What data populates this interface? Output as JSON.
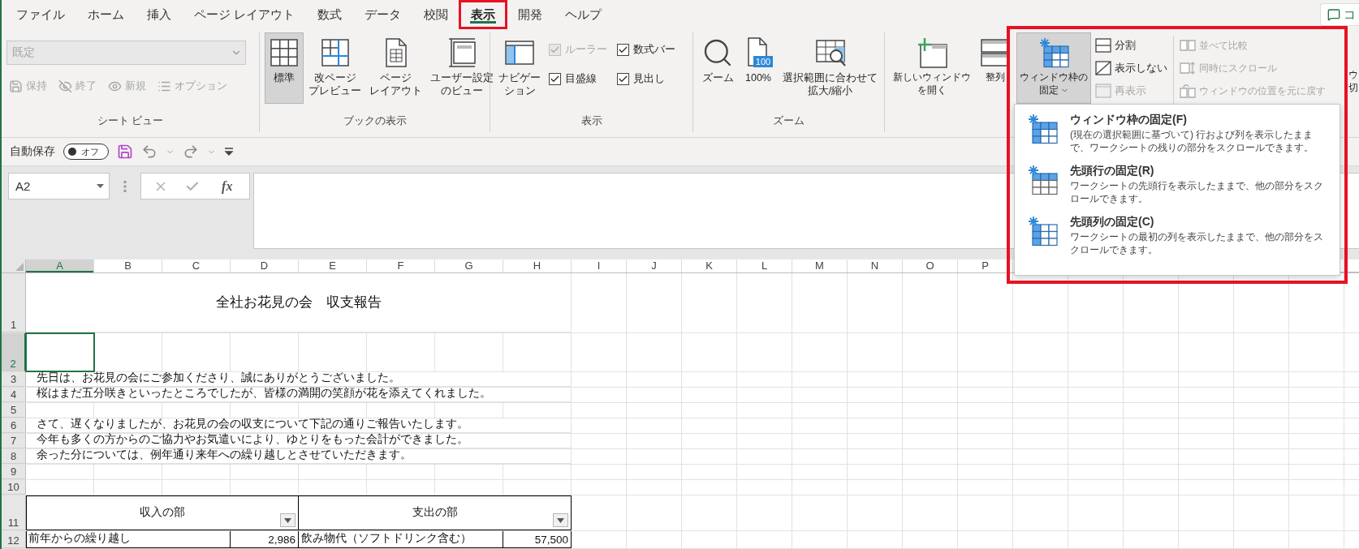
{
  "tabs": [
    {
      "label": "ファイル",
      "selected": false
    },
    {
      "label": "ホーム",
      "selected": false
    },
    {
      "label": "挿入",
      "selected": false
    },
    {
      "label": "ページ レイアウト",
      "selected": false
    },
    {
      "label": "数式",
      "selected": false
    },
    {
      "label": "データ",
      "selected": false
    },
    {
      "label": "校閲",
      "selected": false
    },
    {
      "label": "表示",
      "selected": true
    },
    {
      "label": "開発",
      "selected": false
    },
    {
      "label": "ヘルプ",
      "selected": false
    }
  ],
  "comment_button": {
    "label": "コ"
  },
  "ribbon": {
    "sheet_view": {
      "title": "シート ビュー",
      "view_select": {
        "value": "既定",
        "disabled": true
      },
      "buttons": [
        {
          "label": "保持",
          "disabled": true
        },
        {
          "label": "終了",
          "disabled": true
        },
        {
          "label": "新規",
          "disabled": true
        },
        {
          "label": "オプション",
          "disabled": true
        }
      ]
    },
    "workbook_views": {
      "title": "ブックの表示",
      "buttons": [
        {
          "lines": [
            "標準"
          ],
          "selected": true
        },
        {
          "lines": [
            "改ページ",
            "プレビュー"
          ],
          "selected": false
        },
        {
          "lines": [
            "ページ",
            "レイアウト"
          ],
          "selected": false
        },
        {
          "lines": [
            "ユーザー設定",
            "のビュー"
          ],
          "selected": false
        }
      ]
    },
    "show": {
      "title": "表示",
      "navigation": {
        "lines": [
          "ナビゲー",
          "ション"
        ]
      },
      "options": [
        {
          "label": "ルーラー",
          "checked": true,
          "disabled": true
        },
        {
          "label": "数式バー",
          "checked": true,
          "disabled": false
        },
        {
          "label": "目盛線",
          "checked": true,
          "disabled": false
        },
        {
          "label": "見出し",
          "checked": true,
          "disabled": false
        }
      ]
    },
    "zoom": {
      "title": "ズーム",
      "buttons": [
        {
          "lines": [
            "ズーム"
          ]
        },
        {
          "lines": [
            "100%"
          ],
          "badge": "100"
        },
        {
          "lines": [
            "選択範囲に合わせて",
            "拡大/縮小"
          ]
        }
      ]
    },
    "window": {
      "large_buttons": [
        {
          "lines": [
            "新しいウィンドウ",
            "を開く"
          ]
        },
        {
          "lines": [
            "整列"
          ]
        },
        {
          "lines": [
            "ウィンドウ枠の",
            "固定"
          ],
          "expanded": true
        }
      ],
      "view_options": [
        {
          "label": "分割",
          "disabled": false
        },
        {
          "label": "表示しない",
          "disabled": false
        },
        {
          "label": "再表示",
          "disabled": true
        }
      ],
      "side_by_side": [
        {
          "label": "並べて比較",
          "disabled": true
        },
        {
          "label": "同時にスクロール",
          "disabled": true
        },
        {
          "label": "ウィンドウの位置を元に戻す",
          "disabled": true
        }
      ],
      "switch_button": {
        "lines": [
          "ウ",
          "切"
        ]
      }
    }
  },
  "quick_access": {
    "autosave_label": "自動保存",
    "autosave": {
      "on": false,
      "label": "オフ"
    }
  },
  "formula_bar": {
    "name_box": "A2",
    "function_label": "fx"
  },
  "sheet": {
    "columns": [
      {
        "label": "A",
        "selected": true
      },
      {
        "label": "B",
        "selected": false
      },
      {
        "label": "C",
        "selected": false
      },
      {
        "label": "D",
        "selected": false
      },
      {
        "label": "E",
        "selected": false
      },
      {
        "label": "F",
        "selected": false
      },
      {
        "label": "G",
        "selected": false
      },
      {
        "label": "H",
        "selected": false
      },
      {
        "label": "I",
        "selected": false
      },
      {
        "label": "J",
        "selected": false
      },
      {
        "label": "K",
        "selected": false
      },
      {
        "label": "L",
        "selected": false
      },
      {
        "label": "M",
        "selected": false
      },
      {
        "label": "N",
        "selected": false
      },
      {
        "label": "O",
        "selected": false
      },
      {
        "label": "P",
        "selected": false
      }
    ],
    "rows": [
      {
        "header": "1",
        "selected": false,
        "kind": "title",
        "cells": [
          "全社お花見の会　収支報告"
        ]
      },
      {
        "header": "2",
        "selected": true,
        "kind": "tall"
      },
      {
        "header": "3",
        "selected": false,
        "kind": "text",
        "cells": [
          "先日は、お花見の会にご参加くださり、誠にありがとうございました。"
        ]
      },
      {
        "header": "4",
        "selected": false,
        "kind": "text",
        "cells": [
          "桜はまだ五分咲きといったところでしたが、皆様の満開の笑顔が花を添えてくれました。"
        ]
      },
      {
        "header": "5",
        "selected": false,
        "kind": "empty"
      },
      {
        "header": "6",
        "selected": false,
        "kind": "text",
        "cells": [
          "さて、遅くなりましたが、お花見の会の収支について下記の通りご報告いたします。"
        ]
      },
      {
        "header": "7",
        "selected": false,
        "kind": "text",
        "cells": [
          "今年も多くの方からのご協力やお気遣いにより、ゆとりをもった会計ができました。"
        ]
      },
      {
        "header": "8",
        "selected": false,
        "kind": "text",
        "cells": [
          "余った分については、例年通り来年への繰り越しとさせていただきます。"
        ]
      },
      {
        "header": "9",
        "selected": false,
        "kind": "empty"
      },
      {
        "header": "10",
        "selected": false,
        "kind": "empty"
      },
      {
        "header": "11",
        "selected": false,
        "kind": "table_header",
        "cells": [
          "収入の部",
          "支出の部"
        ]
      },
      {
        "header": "12",
        "selected": false,
        "kind": "table_row",
        "cells": [
          "前年からの繰り越し",
          "2,986",
          "飲み物代（ソフトドリンク含む）",
          "57,500"
        ]
      }
    ]
  },
  "freeze_menu": {
    "items": [
      {
        "title": "ウィンドウ枠の固定(F)",
        "description": "(現在の選択範囲に基づいて) 行および列を表示したままで、ワークシートの残りの部分をスクロールできます。"
      },
      {
        "title": "先頭行の固定(R)",
        "description": "ワークシートの先頭行を表示したままで、他の部分をスクロールできます。"
      },
      {
        "title": "先頭列の固定(C)",
        "description": "ワークシートの最初の列を表示したままで、他の部分をスクロールできます。"
      }
    ]
  }
}
